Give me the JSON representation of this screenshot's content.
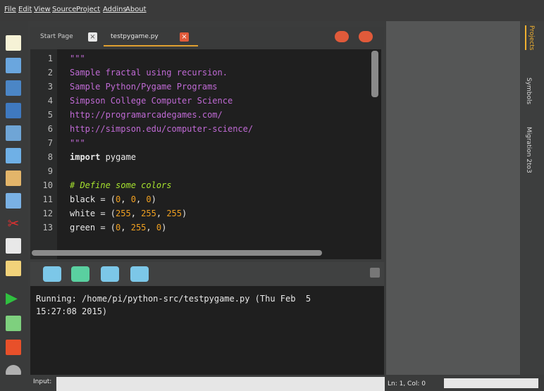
{
  "menu": [
    "File",
    "Edit",
    "View",
    "Source",
    "Project",
    "Addins",
    "About"
  ],
  "tabs": [
    {
      "label": "Start Page",
      "close": "×"
    },
    {
      "label": "testpygame.py",
      "close": "×"
    }
  ],
  "editor": {
    "line_numbers": [
      "1",
      "2",
      "3",
      "4",
      "5",
      "6",
      "7",
      "8",
      "9",
      "10",
      "11",
      "12",
      "13"
    ],
    "lines": [
      {
        "segments": [
          {
            "t": "\"\"\"",
            "c": "cmt"
          }
        ]
      },
      {
        "segments": [
          {
            "t": "Sample fractal using recursion.",
            "c": "cmt"
          }
        ]
      },
      {
        "segments": [
          {
            "t": "Sample Python/Pygame Programs",
            "c": "cmt"
          }
        ]
      },
      {
        "segments": [
          {
            "t": "Simpson College Computer Science",
            "c": "cmt"
          }
        ]
      },
      {
        "segments": [
          {
            "t": "http://programarcadegames.com/",
            "c": "cmt"
          }
        ]
      },
      {
        "segments": [
          {
            "t": "http://simpson.edu/computer-science/",
            "c": "cmt"
          }
        ]
      },
      {
        "segments": [
          {
            "t": "\"\"\"",
            "c": "cmt"
          }
        ]
      },
      {
        "segments": [
          {
            "t": "import",
            "c": "kw"
          },
          {
            "t": " pygame",
            "c": "plain"
          }
        ]
      },
      {
        "segments": [
          {
            "t": "",
            "c": "plain"
          }
        ]
      },
      {
        "segments": [
          {
            "t": "# Define some colors",
            "c": "it"
          }
        ]
      },
      {
        "segments": [
          {
            "t": "black = (",
            "c": "plain"
          },
          {
            "t": "0",
            "c": "num"
          },
          {
            "t": ", ",
            "c": "plain"
          },
          {
            "t": "0",
            "c": "num"
          },
          {
            "t": ", ",
            "c": "plain"
          },
          {
            "t": "0",
            "c": "num"
          },
          {
            "t": ")",
            "c": "plain"
          }
        ]
      },
      {
        "segments": [
          {
            "t": "white = (",
            "c": "plain"
          },
          {
            "t": "255",
            "c": "num"
          },
          {
            "t": ", ",
            "c": "plain"
          },
          {
            "t": "255",
            "c": "num"
          },
          {
            "t": ", ",
            "c": "plain"
          },
          {
            "t": "255",
            "c": "num"
          },
          {
            "t": ")",
            "c": "plain"
          }
        ]
      },
      {
        "segments": [
          {
            "t": "green = (",
            "c": "plain"
          },
          {
            "t": "0",
            "c": "num"
          },
          {
            "t": ", ",
            "c": "plain"
          },
          {
            "t": "255",
            "c": "num"
          },
          {
            "t": ", ",
            "c": "plain"
          },
          {
            "t": "0",
            "c": "num"
          },
          {
            "t": ")",
            "c": "plain"
          }
        ]
      }
    ]
  },
  "console": {
    "lines": [
      "Running: /home/pi/python-src/testpygame.py (Thu Feb  5",
      "15:27:08 2015)"
    ]
  },
  "right_tabs": [
    "Projects",
    "Symbols",
    "Migration 2to3"
  ],
  "input": {
    "label": "Input:"
  },
  "status": {
    "text": "Ln: 1, Col: 0"
  },
  "colors": {
    "accent": "#e05a3a",
    "run": "#5ad0a0",
    "tool": "#7cc7e8"
  }
}
